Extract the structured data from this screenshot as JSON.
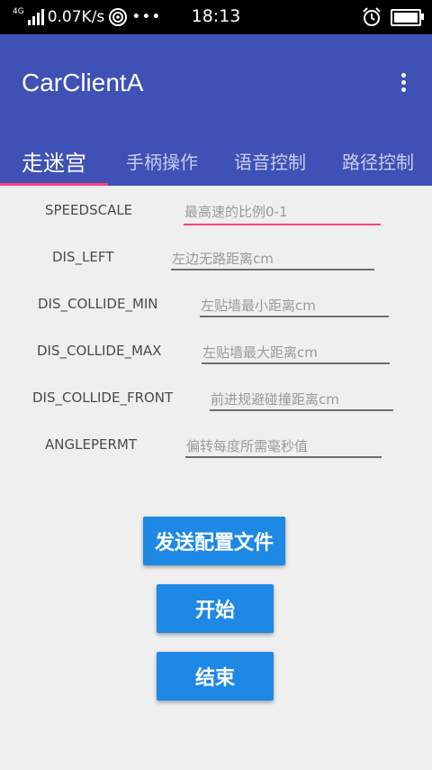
{
  "status_bar": {
    "network": "4G",
    "speed": "0.07K/s",
    "more": "•••",
    "time": "18:13"
  },
  "app_bar": {
    "title": "CarClientA",
    "menu_icon": "more-vert-icon"
  },
  "tabs": [
    {
      "label": "走迷宫",
      "active": true
    },
    {
      "label": "手柄操作",
      "active": false
    },
    {
      "label": "语音控制",
      "active": false
    },
    {
      "label": "路径控制",
      "active": false
    }
  ],
  "form": {
    "fields": [
      {
        "label": "SPEEDSCALE",
        "placeholder": "最高速的比例0-1",
        "value": ""
      },
      {
        "label": "DIS_LEFT",
        "placeholder": "左边无路距离cm",
        "value": ""
      },
      {
        "label": "DIS_COLLIDE_MIN",
        "placeholder": "左贴墙最小距离cm",
        "value": ""
      },
      {
        "label": "DIS_COLLIDE_MAX",
        "placeholder": "左贴墙最大距离cm",
        "value": ""
      },
      {
        "label": "DIS_COLLIDE_FRONT",
        "placeholder": "前进规避碰撞距离cm",
        "value": ""
      },
      {
        "label": "ANGLEPERMT",
        "placeholder": "偏转每度所需毫秒值",
        "value": ""
      }
    ]
  },
  "buttons": {
    "send_config": "发送配置文件",
    "start": "开始",
    "stop": "结束"
  },
  "colors": {
    "primary": "#3f51b5",
    "accent": "#ff4081",
    "button": "#1e88e5"
  }
}
